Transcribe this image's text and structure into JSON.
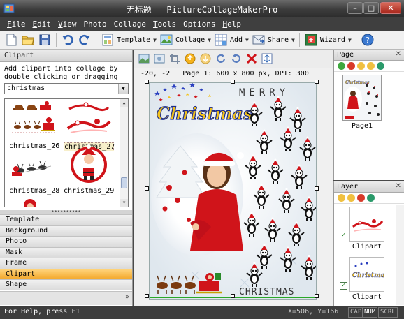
{
  "window": {
    "title": "无标题 - PictureCollageMakerPro"
  },
  "menu": [
    {
      "u": "F",
      "rest": "ile"
    },
    {
      "u": "E",
      "rest": "dit"
    },
    {
      "u": "V",
      "rest": "iew"
    },
    {
      "u": "",
      "rest": "Photo"
    },
    {
      "u": "",
      "rest": "Collage"
    },
    {
      "u": "T",
      "rest": "ools"
    },
    {
      "u": "",
      "rest": "Options"
    },
    {
      "u": "H",
      "rest": "elp"
    }
  ],
  "toolbar": {
    "template": "Template",
    "collage": "Collage",
    "add": "Add",
    "share": "Share",
    "wizard": "Wizard"
  },
  "clipart": {
    "header": "Clipart",
    "description": "Add clipart into collage by double clicking or dragging",
    "category": "christmas",
    "items": [
      "christmas_26",
      "christmas_27",
      "christmas_28",
      "christmas_29"
    ],
    "selected_item": "christmas_27"
  },
  "categories": [
    "Template",
    "Background",
    "Photo",
    "Mask",
    "Frame",
    "Clipart",
    "Shape"
  ],
  "active_category": "Clipart",
  "canvas": {
    "position": "-20, -2",
    "page_info": "Page 1: 600 x 800 px, DPI: 300"
  },
  "poster": {
    "top_text": "MERRY",
    "bottom_text": "CHRISTMAS",
    "headline": "Christmas"
  },
  "page_panel": {
    "title": "Page",
    "page_label": "Page1"
  },
  "layer_panel": {
    "title": "Layer",
    "layers": [
      "Clipart",
      "Clipart"
    ]
  },
  "status": {
    "help": "For Help, press F1",
    "coords": "X=506, Y=166",
    "cap": "CAP",
    "num": "NUM",
    "scrl": "SCRL"
  },
  "colors": {
    "active_category": "#f3a72a",
    "title_bar": "#3d3d3d",
    "xmas_red": "#d0141a",
    "xmas_green": "#2a8a2a"
  }
}
